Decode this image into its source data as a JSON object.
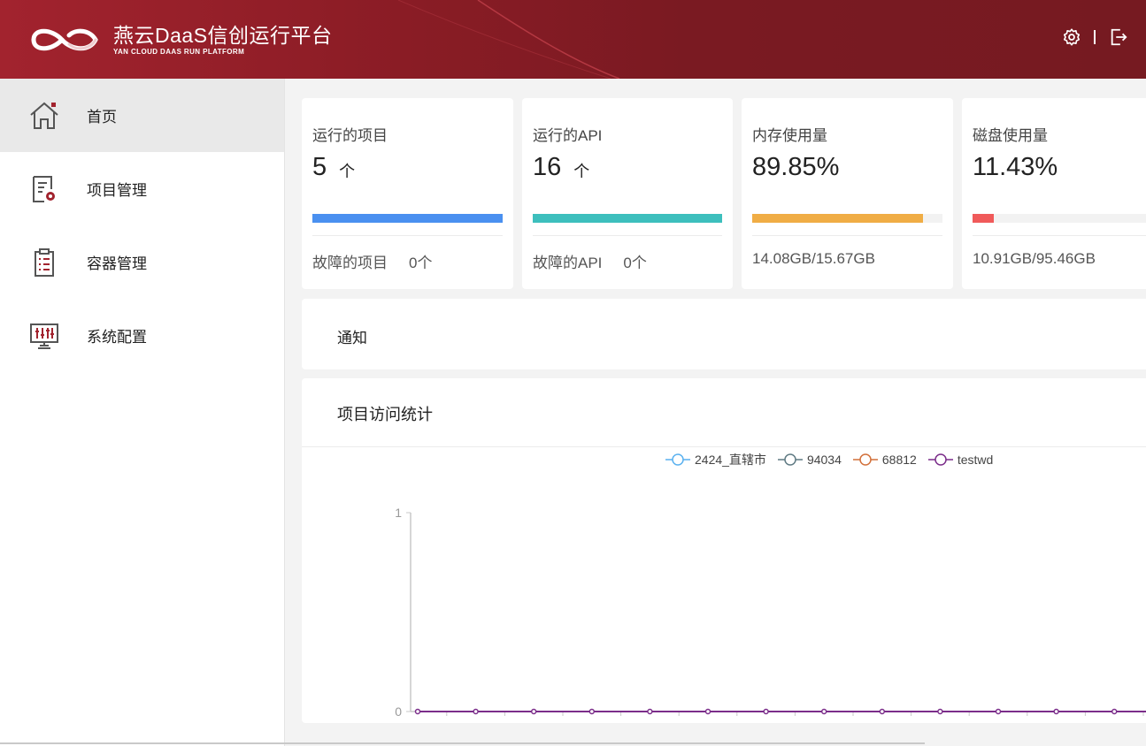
{
  "header": {
    "brand_title": "燕云DaaS信创运行平台",
    "brand_sub": "YAN CLOUD DAAS  RUN PLATFORM",
    "colors": {
      "bg": "#7a1a22",
      "accent": "#a2232e"
    },
    "tools": {
      "settings_icon": "gear-icon",
      "logout_icon": "logout-icon"
    }
  },
  "sidebar": {
    "items": [
      {
        "label": "首页",
        "icon": "home-icon",
        "active": true
      },
      {
        "label": "项目管理",
        "icon": "project-settings-icon",
        "active": false
      },
      {
        "label": "容器管理",
        "icon": "clipboard-icon",
        "active": false
      },
      {
        "label": "系统配置",
        "icon": "monitor-sliders-icon",
        "active": false
      }
    ]
  },
  "cards": [
    {
      "title": "运行的项目",
      "value": "5",
      "unit": "个",
      "bar_color": "#4a90f0",
      "progress": 1.0,
      "foot_label": "故障的项目",
      "foot_value": "0个"
    },
    {
      "title": "运行的API",
      "value": "16",
      "unit": "个",
      "bar_color": "#3dbfbd",
      "progress": 1.0,
      "foot_label": "故障的API",
      "foot_value": "0个"
    },
    {
      "title": "内存使用量",
      "value": "89.85%",
      "unit": "",
      "bar_color": "#f0ad45",
      "progress": 0.8985,
      "foot_label": "14.08GB/15.67GB",
      "foot_value": ""
    },
    {
      "title": "磁盘使用量",
      "value": "11.43%",
      "unit": "",
      "bar_color": "#f05a5a",
      "progress": 0.1143,
      "foot_label": "10.91GB/95.46GB",
      "foot_value": ""
    }
  ],
  "notice": {
    "title": "通知"
  },
  "stats_panel": {
    "title": "项目访问统计"
  },
  "chart_data": {
    "type": "line",
    "ylim": [
      0,
      1
    ],
    "yticks": [
      "0",
      "1"
    ],
    "series": [
      {
        "name": "2424_直辖市",
        "color": "#5ab1ef",
        "values": [
          0,
          0,
          0,
          0,
          0,
          0,
          0,
          0,
          0,
          0,
          0,
          0,
          0
        ]
      },
      {
        "name": "94034",
        "color": "#5f7a83",
        "values": [
          0,
          0,
          0,
          0,
          0,
          0,
          0,
          0,
          0,
          0,
          0,
          0,
          0
        ]
      },
      {
        "name": "68812",
        "color": "#d2703a",
        "values": [
          0,
          0,
          0,
          0,
          0,
          0,
          0,
          0,
          0,
          0,
          0,
          0,
          0
        ]
      },
      {
        "name": "testwd",
        "color": "#7b2d8a",
        "values": [
          0,
          0,
          0,
          0,
          0,
          0,
          0,
          0,
          0,
          0,
          0,
          0,
          0
        ]
      }
    ]
  }
}
